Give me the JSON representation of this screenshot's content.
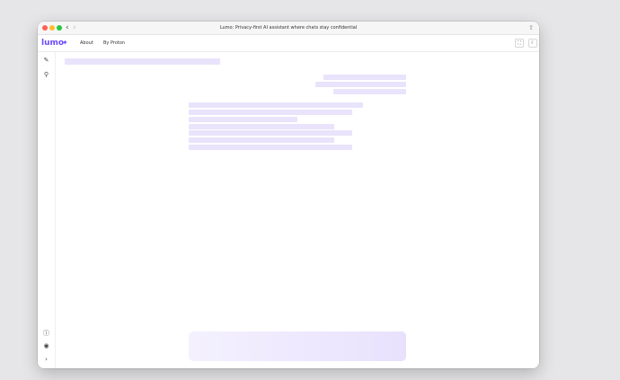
{
  "window": {
    "title": "Lumo: Privacy-first AI assistant where chats stay confidential"
  },
  "header": {
    "logo_text": "lumo",
    "nav": [
      {
        "label": "About"
      },
      {
        "label": "By Proton"
      }
    ]
  },
  "colors": {
    "brand": "#6d4aff",
    "skeleton": "#e9e3fb"
  },
  "icons": {
    "sidebar": [
      "new-chat-icon",
      "search-icon",
      "help-icon",
      "privacy-icon",
      "expand-sidebar-icon"
    ],
    "header": [
      "expand-icon",
      "theme-icon"
    ]
  }
}
